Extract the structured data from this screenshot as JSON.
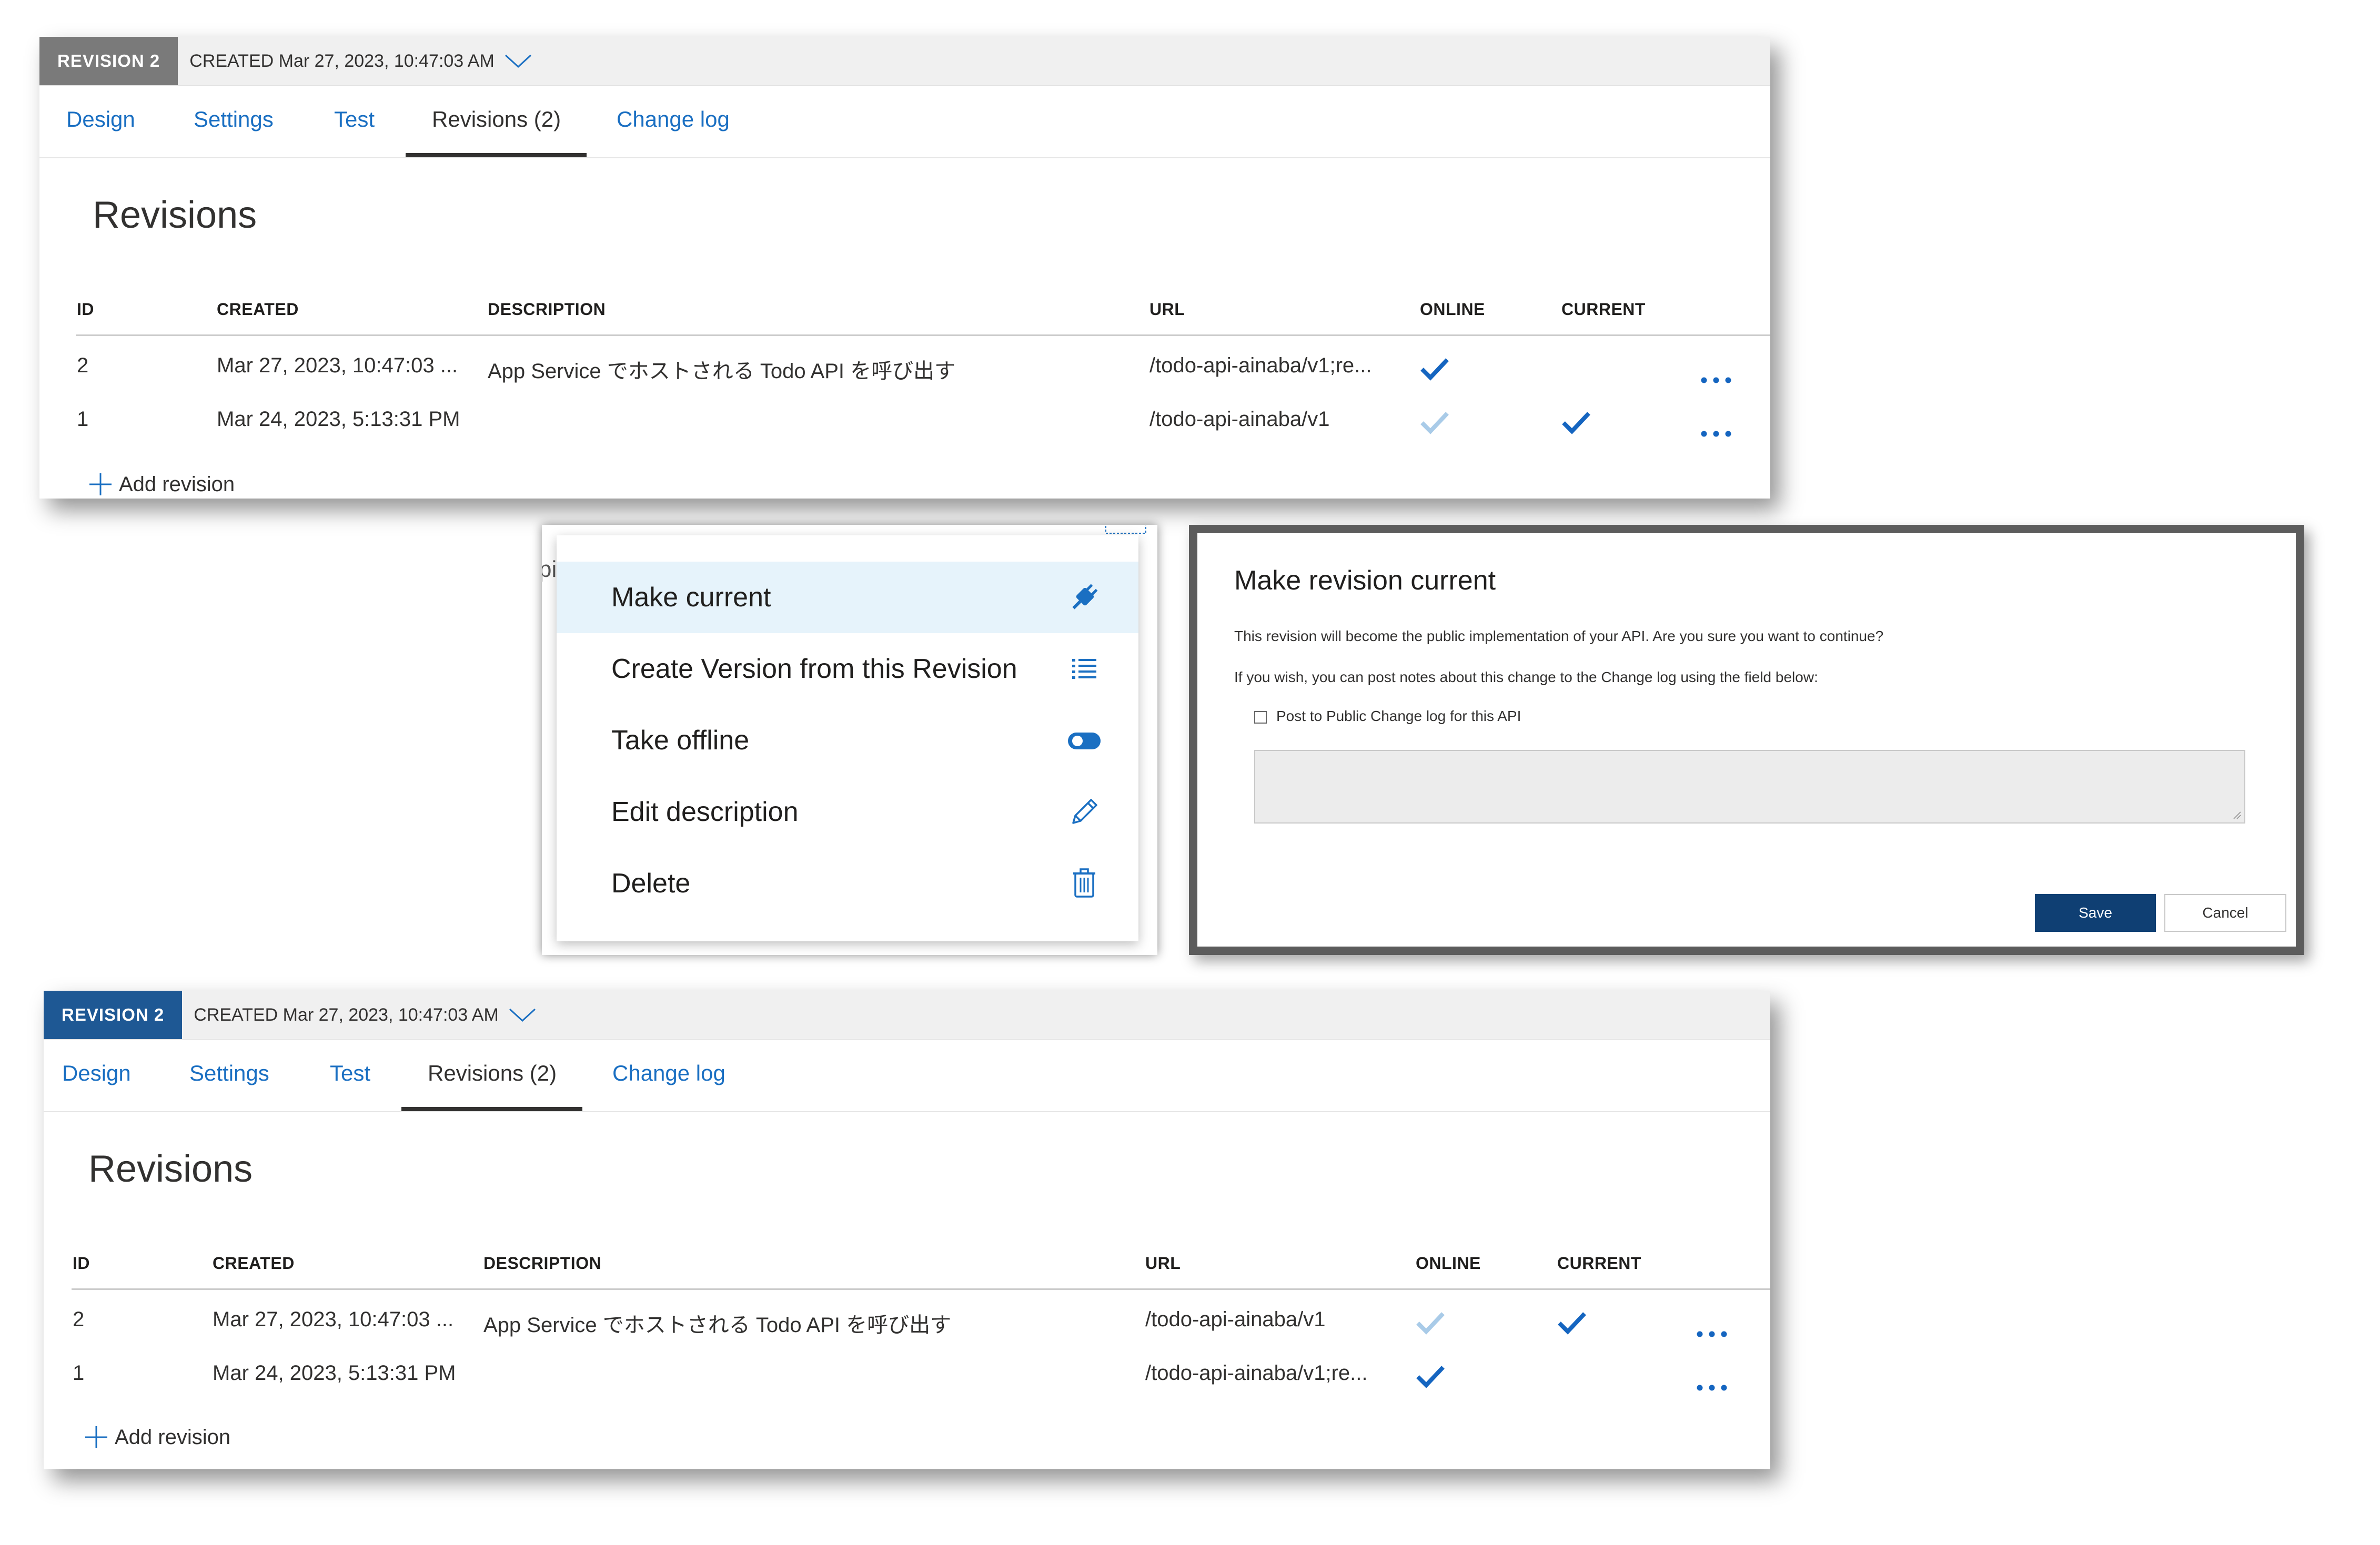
{
  "colors": {
    "link_blue": "#1a6fc2",
    "check_blue": "#1565c0",
    "check_light": "#a9cbe8",
    "badge_gray": "#7a7a7a",
    "badge_blue": "#1e5894",
    "save_button": "#0f3f73"
  },
  "top_panel": {
    "badge": "REVISION 2",
    "created": "CREATED Mar 27, 2023, 10:47:03 AM",
    "tabs": [
      {
        "label": "Design"
      },
      {
        "label": "Settings"
      },
      {
        "label": "Test"
      },
      {
        "label": "Revisions (2)",
        "active": true
      },
      {
        "label": "Change log"
      }
    ],
    "title": "Revisions",
    "columns": [
      "ID",
      "CREATED",
      "DESCRIPTION",
      "URL",
      "ONLINE",
      "CURRENT"
    ],
    "rows": [
      {
        "id": "2",
        "created": "Mar 27, 2023, 10:47:03 ...",
        "description": "App Service でホストされる Todo API を呼び出す",
        "url": "/todo-api-ainaba/v1;re...",
        "online": "dark",
        "current": false
      },
      {
        "id": "1",
        "created": "Mar 24, 2023, 5:13:31 PM",
        "description": "",
        "url": "/todo-api-ainaba/v1",
        "online": "light",
        "current": true
      }
    ],
    "add_revision": "Add revision"
  },
  "context_menu": {
    "items": [
      {
        "label": "Make current",
        "icon": "plug-icon"
      },
      {
        "label": "Create Version from this Revision",
        "icon": "list-icon"
      },
      {
        "label": "Take offline",
        "icon": "toggle-icon"
      },
      {
        "label": "Edit description",
        "icon": "pencil-icon"
      },
      {
        "label": "Delete",
        "icon": "trash-icon"
      }
    ],
    "fragment": "pi"
  },
  "dialog": {
    "title": "Make revision current",
    "line1": "This revision will become the public implementation of your API. Are you sure you want to continue?",
    "line2": "If you wish, you can post notes about this change to the Change log using the field below:",
    "checkbox_label": "Post to Public Change log for this API",
    "save": "Save",
    "cancel": "Cancel"
  },
  "bottom_panel": {
    "badge": "REVISION 2",
    "created": "CREATED Mar 27, 2023, 10:47:03 AM",
    "tabs": [
      {
        "label": "Design"
      },
      {
        "label": "Settings"
      },
      {
        "label": "Test"
      },
      {
        "label": "Revisions (2)",
        "active": true
      },
      {
        "label": "Change log"
      }
    ],
    "title": "Revisions",
    "columns": [
      "ID",
      "CREATED",
      "DESCRIPTION",
      "URL",
      "ONLINE",
      "CURRENT"
    ],
    "rows": [
      {
        "id": "2",
        "created": "Mar 27, 2023, 10:47:03 ...",
        "description": "App Service でホストされる Todo API を呼び出す",
        "url": "/todo-api-ainaba/v1",
        "online": "light",
        "current": true
      },
      {
        "id": "1",
        "created": "Mar 24, 2023, 5:13:31 PM",
        "description": "",
        "url": "/todo-api-ainaba/v1;re...",
        "online": "dark",
        "current": false
      }
    ],
    "add_revision": "Add revision"
  }
}
